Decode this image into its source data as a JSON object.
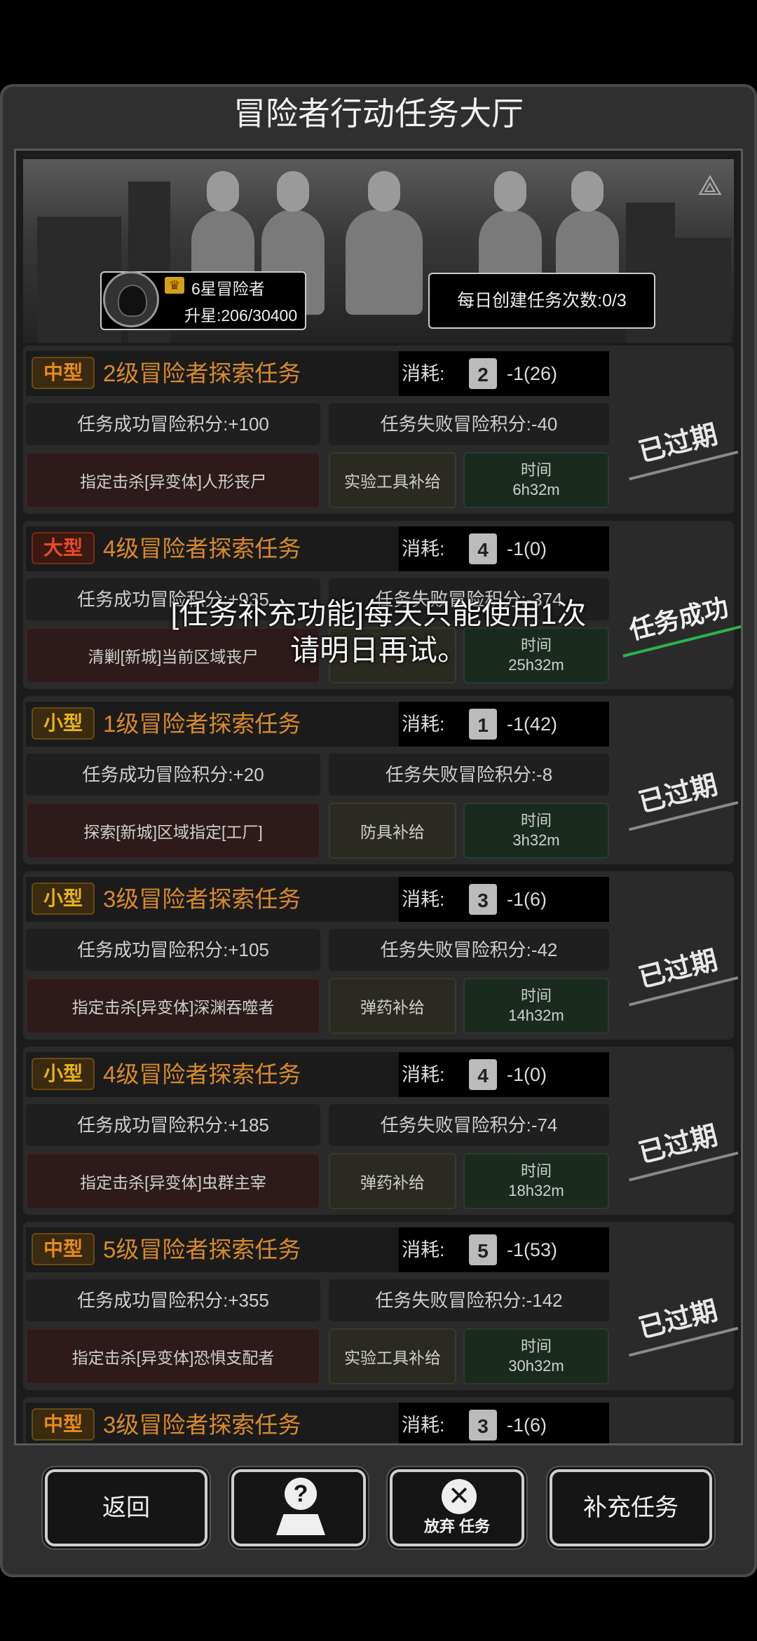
{
  "title": "冒险者行动任务大厅",
  "rank": {
    "title": "6星冒险者",
    "progress": "升星:206/30400"
  },
  "daily": {
    "text": "每日创建任务次数:0/3"
  },
  "labels": {
    "cost": "消耗:"
  },
  "tasks": [
    {
      "size": "中型",
      "title": "2级冒险者探索任务",
      "lv": "2",
      "cost": "-1(26)",
      "success": "任务成功冒险积分:+100",
      "fail": "任务失败冒险积分:-40",
      "goal": "指定击杀[异变体]人形丧尸",
      "supply": "实验工具补给",
      "time_label": "时间",
      "time": "6h32m",
      "status": "已过期"
    },
    {
      "size": "大型",
      "title": "4级冒险者探索任务",
      "lv": "4",
      "cost": "-1(0)",
      "success": "任务成功冒险积分:+935",
      "fail": "任务失败冒险积分:-374",
      "goal": "清剿[新城]当前区域丧尸",
      "supply": "",
      "time_label": "时间",
      "time": "25h32m",
      "status": "任务成功"
    },
    {
      "size": "小型",
      "title": "1级冒险者探索任务",
      "lv": "1",
      "cost": "-1(42)",
      "success": "任务成功冒险积分:+20",
      "fail": "任务失败冒险积分:-8",
      "goal": "探索[新城]区域指定[工厂]",
      "supply": "防具补给",
      "time_label": "时间",
      "time": "3h32m",
      "status": "已过期"
    },
    {
      "size": "小型",
      "title": "3级冒险者探索任务",
      "lv": "3",
      "cost": "-1(6)",
      "success": "任务成功冒险积分:+105",
      "fail": "任务失败冒险积分:-42",
      "goal": "指定击杀[异变体]深渊吞噬者",
      "supply": "弹药补给",
      "time_label": "时间",
      "time": "14h32m",
      "status": "已过期"
    },
    {
      "size": "小型",
      "title": "4级冒险者探索任务",
      "lv": "4",
      "cost": "-1(0)",
      "success": "任务成功冒险积分:+185",
      "fail": "任务失败冒险积分:-74",
      "goal": "指定击杀[异变体]虫群主宰",
      "supply": "弹药补给",
      "time_label": "时间",
      "time": "18h32m",
      "status": "已过期"
    },
    {
      "size": "中型",
      "title": "5级冒险者探索任务",
      "lv": "5",
      "cost": "-1(53)",
      "success": "任务成功冒险积分:+355",
      "fail": "任务失败冒险积分:-142",
      "goal": "指定击杀[异变体]恐惧支配者",
      "supply": "实验工具补给",
      "time_label": "时间",
      "time": "30h32m",
      "status": "已过期"
    },
    {
      "size": "中型",
      "title": "3级冒险者探索任务",
      "lv": "3",
      "cost": "-1(6)"
    }
  ],
  "toast": {
    "line1": "[任务补充功能]每天只能使用1次",
    "line2": "请明日再试。"
  },
  "buttons": {
    "back": "返回",
    "abandon": "放弃 任务",
    "supplement": "补充任务"
  },
  "icons": {
    "help": "help-map-icon",
    "abandon": "close-circle-icon",
    "crown": "crown-icon",
    "lv": "level-card-icon"
  }
}
